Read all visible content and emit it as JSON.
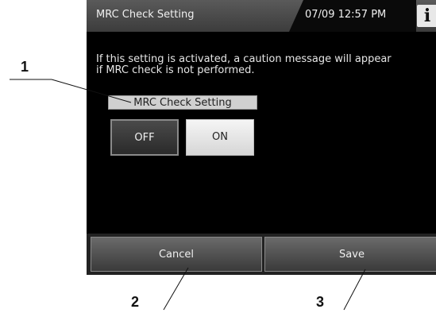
{
  "header": {
    "title": "MRC Check Setting",
    "datetime": "07/09 12:57 PM",
    "info_icon_glyph": "i",
    "info_icon": "info-icon"
  },
  "main": {
    "description_line1": "If this setting is activated, a caution message will appear",
    "description_line2": "if MRC check is not performed.",
    "setting_label": "MRC Check Setting",
    "off_label": "OFF",
    "on_label": "ON",
    "selected": "ON"
  },
  "footer": {
    "cancel_label": "Cancel",
    "save_label": "Save"
  },
  "callouts": {
    "c1": "1",
    "c2": "2",
    "c3": "3"
  },
  "colors": {
    "screen_bg": "#000000",
    "selected_button": "#e8e8e8",
    "unselected_button": "#2a2a2a"
  }
}
